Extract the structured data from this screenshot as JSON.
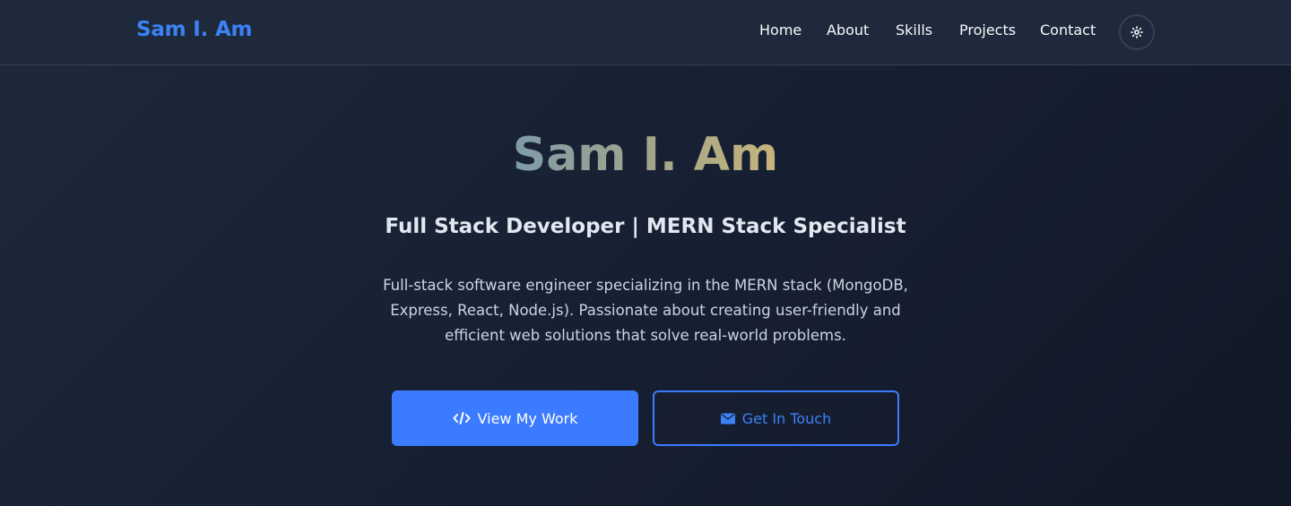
{
  "nav": {
    "brand": "Sam I. Am",
    "links": {
      "home": "Home",
      "about": "About",
      "skills": "Skills",
      "projects": "Projects",
      "contact": "Contact"
    },
    "theme_toggle_icon": "sun-icon"
  },
  "hero": {
    "title": "Sam I. Am",
    "subtitle": "Full Stack Developer | MERN Stack Specialist",
    "description": "Full-stack software engineer specializing in the MERN stack (MongoDB, Express, React, Node.js). Passionate about creating user-friendly and efficient web solutions that solve real-world problems.",
    "primary_button": {
      "label": "View My Work",
      "icon": "code-icon"
    },
    "secondary_button": {
      "label": "Get In Touch",
      "icon": "envelope-icon"
    }
  },
  "colors": {
    "accent": "#3b82f6",
    "button_primary": "#3b7bff",
    "nav_background": "#1e293b",
    "background": "#111827"
  }
}
